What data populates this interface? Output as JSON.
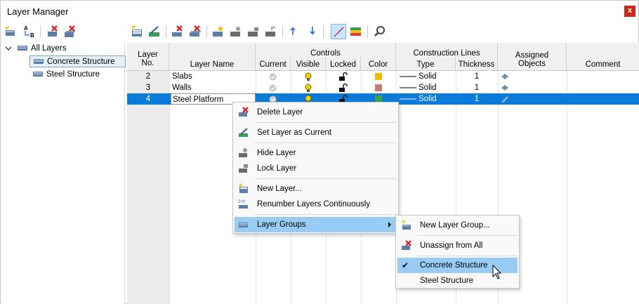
{
  "window": {
    "title": "Layer Manager",
    "close_label": "x"
  },
  "tree": {
    "root": "All Layers",
    "items": [
      "Concrete Structure",
      "Steel Structure"
    ],
    "selected_index": 0
  },
  "grid": {
    "headers": {
      "layer_no": "Layer",
      "layer_no2": "No.",
      "layer_name": "Layer Name",
      "controls": "Controls",
      "current": "Current",
      "visible": "Visible",
      "locked": "Locked",
      "color": "Color",
      "construction_lines": "Construction Lines",
      "type": "Type",
      "thickness": "Thickness",
      "assigned": "Assigned",
      "objects": "Objects",
      "comment": "Comment"
    },
    "rows": [
      {
        "no": "2",
        "name": "Slabs",
        "color": "#f5b800",
        "type": "Solid",
        "thickness": "1"
      },
      {
        "no": "3",
        "name": "Walls",
        "color": "#c27c7a",
        "type": "Solid",
        "thickness": "1"
      },
      {
        "no": "4",
        "name": "Steel Platform",
        "color": "#3aa24a",
        "type": "Solid",
        "thickness": "1"
      }
    ],
    "selected_row": 2
  },
  "context_menu": {
    "items": [
      {
        "label": "Delete Layer",
        "icon": "delete-layer-icon"
      },
      {
        "label": "Set Layer as Current",
        "icon": "set-current-icon"
      },
      {
        "label": "Hide Layer",
        "icon": "hide-layer-icon"
      },
      {
        "label": "Lock Layer",
        "icon": "lock-layer-icon"
      },
      {
        "label": "New Layer...",
        "icon": "new-layer-icon"
      },
      {
        "label": "Renumber Layers Continuously",
        "icon": "renumber-icon"
      },
      {
        "label": "Layer Groups",
        "icon": "layer-groups-icon"
      }
    ]
  },
  "submenu": {
    "items": [
      {
        "label": "New Layer Group...",
        "icon": "new-layer-group-icon"
      },
      {
        "label": "Unassign from All",
        "icon": "unassign-icon"
      },
      {
        "label": "Concrete Structure",
        "icon": "checkmark-icon"
      },
      {
        "label": "Steel Structure",
        "icon": ""
      }
    ],
    "checkmark": "✔"
  }
}
